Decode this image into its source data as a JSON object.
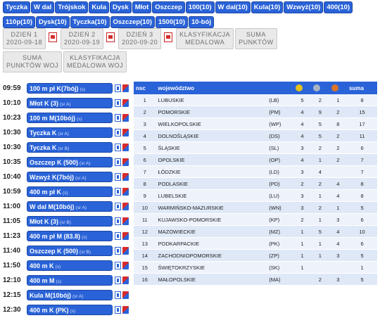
{
  "events": [
    "Tyczka",
    "W dal",
    "Trójskok",
    "Kula",
    "Dysk",
    "Młot",
    "Oszczep",
    "100(10)",
    "W dal(10)",
    "Kula(10)",
    "Wzwyż(10)",
    "400(10)",
    "110p(10)",
    "Dysk(10)",
    "Tyczka(10)",
    "Oszczep(10)",
    "1500(10)",
    "10-bój"
  ],
  "days": [
    {
      "label": "DZIEŃ 1",
      "date": "2020-09-18"
    },
    {
      "label": "DZIEŃ 2",
      "date": "2020-09-19"
    },
    {
      "label": "DZIEŃ 3",
      "date": "2020-09-20"
    },
    {
      "label": "KLASYFIKACJA",
      "date": "MEDALOWA"
    },
    {
      "label": "SUMA",
      "date": "PUNKTÓW"
    }
  ],
  "days2": [
    {
      "label": "SUMA",
      "date": "PUNKTÓW WOJ"
    },
    {
      "label": "KLASYFIKACJA",
      "date": "MEDALOWA WOJ"
    }
  ],
  "schedule": [
    {
      "time": "09:59",
      "event": "100 m pł K(7bój)",
      "tag": "(s)"
    },
    {
      "time": "10:10",
      "event": "Młot K (3)",
      "tag": "(sr A)"
    },
    {
      "time": "10:23",
      "event": "100 m M(10bój)",
      "tag": "(s)"
    },
    {
      "time": "10:30",
      "event": "Tyczka K",
      "tag": "(sr A)"
    },
    {
      "time": "10:30",
      "event": "Tyczka K",
      "tag": "(sr B)"
    },
    {
      "time": "10:35",
      "event": "Oszczep K (500)",
      "tag": "(sr A)"
    },
    {
      "time": "10:40",
      "event": "Wzwyż K(7bój)",
      "tag": "(sr A)"
    },
    {
      "time": "10:59",
      "event": "400 m pł K",
      "tag": "(s)"
    },
    {
      "time": "11:00",
      "event": "W dal M(10bój)",
      "tag": "(sr A)"
    },
    {
      "time": "11:05",
      "event": "Młot K (3)",
      "tag": "(sr B)"
    },
    {
      "time": "11:23",
      "event": "400 m pł M (83.8)",
      "tag": "(s)"
    },
    {
      "time": "11:40",
      "event": "Oszczep K (500)",
      "tag": "(sr B)"
    },
    {
      "time": "11:50",
      "event": "400 m K",
      "tag": "(s)"
    },
    {
      "time": "12:10",
      "event": "400 m M",
      "tag": "(s)"
    },
    {
      "time": "12:15",
      "event": "Kula M(10bój)",
      "tag": "(sr A)"
    },
    {
      "time": "12:30",
      "event": "400 m K (PK)",
      "tag": "(s)"
    }
  ],
  "table": {
    "headers": {
      "rank": "nsc",
      "region": "województwo",
      "sum": "suma"
    },
    "medal_colors": {
      "gold": "#e3c21a",
      "silver": "#a6b4c2",
      "bronze": "#d9742b"
    },
    "rows": [
      {
        "rank": "1",
        "region": "LUBUSKIE",
        "code": "(LB)",
        "g": "5",
        "s": "2",
        "b": "1",
        "sum": "8"
      },
      {
        "rank": "2",
        "region": "POMORSKIE",
        "code": "(PM)",
        "g": "4",
        "s": "9",
        "b": "2",
        "sum": "15"
      },
      {
        "rank": "3",
        "region": "WIELKOPOLSKIE",
        "code": "(WP)",
        "g": "4",
        "s": "5",
        "b": "8",
        "sum": "17"
      },
      {
        "rank": "4",
        "region": "DOLNOŚLĄSKIE",
        "code": "(DS)",
        "g": "4",
        "s": "5",
        "b": "2",
        "sum": "11"
      },
      {
        "rank": "5",
        "region": "ŚLĄSKIE",
        "code": "(SL)",
        "g": "3",
        "s": "2",
        "b": "2",
        "sum": "6"
      },
      {
        "rank": "6",
        "region": "OPOLSKIE",
        "code": "(OP)",
        "g": "4",
        "s": "1",
        "b": "2",
        "sum": "7"
      },
      {
        "rank": "7",
        "region": "ŁÓDZKIE",
        "code": "(LD)",
        "g": "3",
        "s": "4",
        "b": "",
        "sum": "7"
      },
      {
        "rank": "8",
        "region": "PODLASKIE",
        "code": "(PD)",
        "g": "2",
        "s": "2",
        "b": "4",
        "sum": "8"
      },
      {
        "rank": "9",
        "region": "LUBELSKIE",
        "code": "(LU)",
        "g": "3",
        "s": "1",
        "b": "4",
        "sum": "8"
      },
      {
        "rank": "10",
        "region": "WARMIŃSKO-MAZURSKIE",
        "code": "(WN)",
        "g": "3",
        "s": "2",
        "b": "1",
        "sum": "5"
      },
      {
        "rank": "11",
        "region": "KUJAWSKO-POMORSKIE",
        "code": "(KP)",
        "g": "2",
        "s": "1",
        "b": "3",
        "sum": "6"
      },
      {
        "rank": "12",
        "region": "MAZOWIECKIE",
        "code": "(MZ)",
        "g": "1",
        "s": "5",
        "b": "4",
        "sum": "10"
      },
      {
        "rank": "13",
        "region": "PODKARPACKIE",
        "code": "(PK)",
        "g": "1",
        "s": "1",
        "b": "4",
        "sum": "6"
      },
      {
        "rank": "14",
        "region": "ZACHODNIOPOMORSKIE",
        "code": "(ZP)",
        "g": "1",
        "s": "1",
        "b": "3",
        "sum": "5"
      },
      {
        "rank": "15",
        "region": "ŚWIĘTOKRZYSKIE",
        "code": "(SK)",
        "g": "1",
        "s": "",
        "b": "",
        "sum": "1"
      },
      {
        "rank": "16",
        "region": "MAŁOPOLSKIE",
        "code": "(MA)",
        "g": "",
        "s": "2",
        "b": "3",
        "sum": "5"
      }
    ]
  }
}
